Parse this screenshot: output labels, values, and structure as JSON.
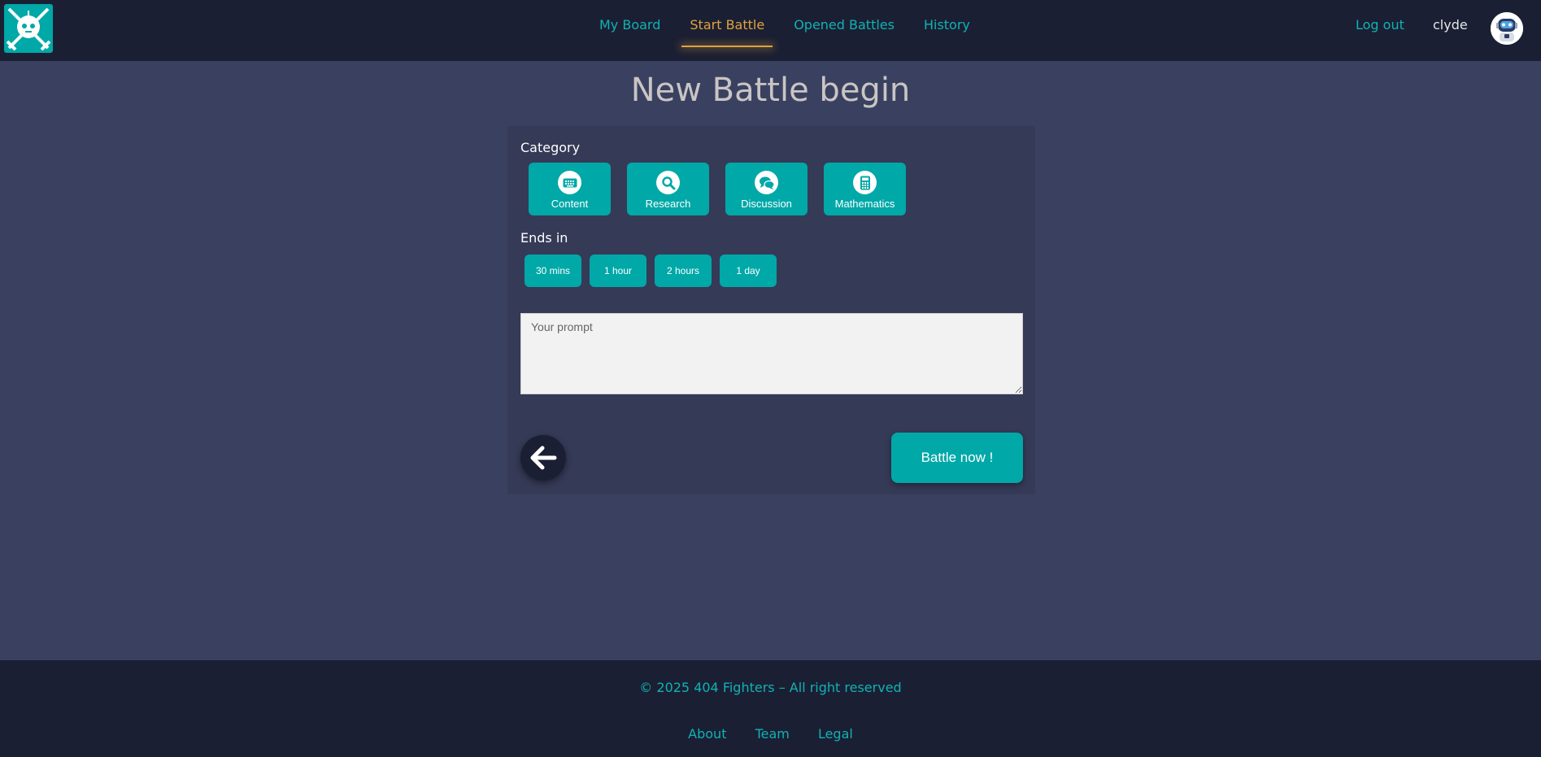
{
  "header": {
    "nav": [
      {
        "label": "My Board",
        "active": false
      },
      {
        "label": "Start Battle",
        "active": true
      },
      {
        "label": "Opened Battles",
        "active": false
      },
      {
        "label": "History",
        "active": false
      }
    ],
    "logout_label": "Log out",
    "username": "clyde"
  },
  "main": {
    "title": "New Battle begin",
    "category_label": "Category",
    "categories": [
      {
        "label": "Content",
        "icon": "keyboard-icon"
      },
      {
        "label": "Research",
        "icon": "search-icon"
      },
      {
        "label": "Discussion",
        "icon": "chat-icon"
      },
      {
        "label": "Mathematics",
        "icon": "calculator-icon"
      }
    ],
    "ends_label": "Ends in",
    "durations": [
      "30 mins",
      "1 hour",
      "2 hours",
      "1 day"
    ],
    "prompt_placeholder": "Your prompt",
    "prompt_value": "",
    "battle_label": "Battle now !"
  },
  "footer": {
    "copyright": "© 2025 404 Fighters – All right reserved",
    "links": [
      "About",
      "Team",
      "Legal"
    ]
  },
  "colors": {
    "accent": "#00a8a8",
    "active_nav": "#e0a33c",
    "page_bg": "#3a4160",
    "header_bg": "#1b1f33"
  }
}
